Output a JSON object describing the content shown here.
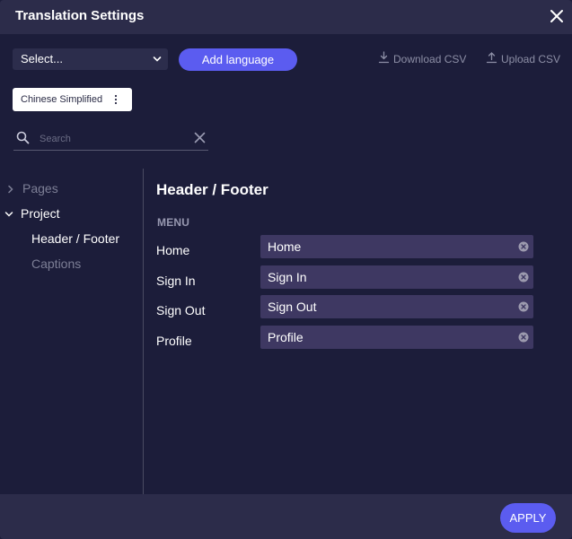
{
  "dialog": {
    "title": "Translation Settings"
  },
  "toolbar": {
    "language_select_value": "Select...",
    "add_language_label": "Add language",
    "download_csv_label": "Download CSV",
    "upload_csv_label": "Upload CSV"
  },
  "language_chip": {
    "label": "Chinese Simplified"
  },
  "search": {
    "placeholder": "Search",
    "value": ""
  },
  "sidebar": {
    "items": [
      {
        "label": "Pages",
        "expanded": false
      },
      {
        "label": "Project",
        "expanded": true
      },
      {
        "label": "Header / Footer",
        "selected": true
      },
      {
        "label": "Captions",
        "selected": false
      }
    ]
  },
  "main": {
    "section_title": "Header / Footer",
    "group_label": "MENU",
    "rows": [
      {
        "label": "Home",
        "value": "Home"
      },
      {
        "label": "Sign In",
        "value": "Sign In"
      },
      {
        "label": "Sign Out",
        "value": "Sign Out"
      },
      {
        "label": "Profile",
        "value": "Profile"
      }
    ]
  },
  "footer": {
    "apply_label": "APPLY"
  },
  "colors": {
    "background": "#1c1d3a",
    "panel": "#2c2c4a",
    "accent": "#5b5cf0",
    "field": "#3e3862",
    "muted_text": "#8d8fa6"
  }
}
